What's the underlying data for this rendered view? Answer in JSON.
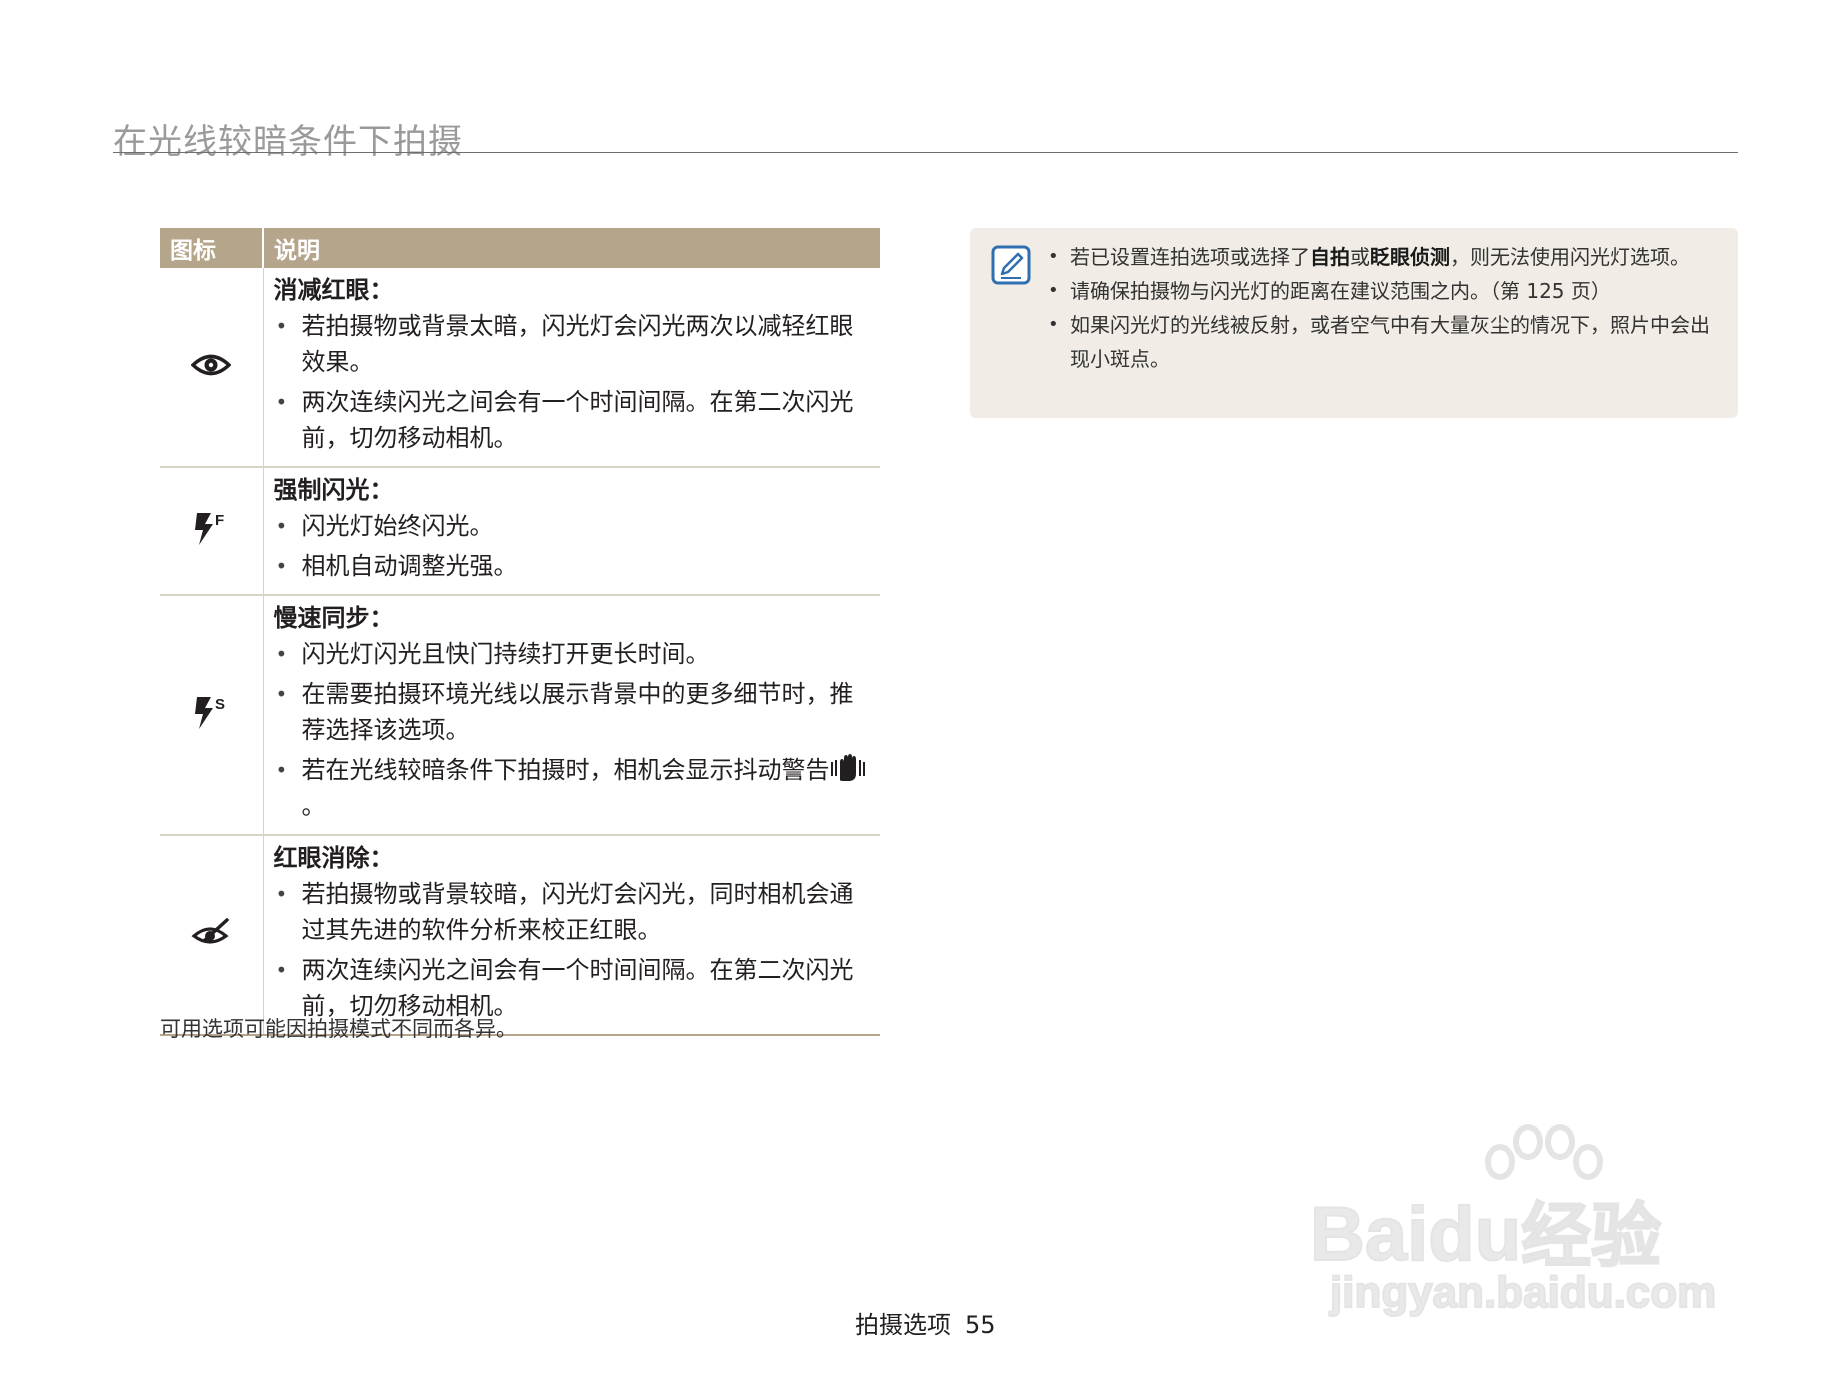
{
  "page": {
    "title": "在光线较暗条件下拍摄",
    "footer_section": "拍摄选项",
    "footer_page": "55"
  },
  "table": {
    "headers": [
      "图标",
      "说明"
    ],
    "rows": [
      {
        "icon": "red-eye-icon",
        "name": "消减红眼：",
        "bullets": [
          "若拍摄物或背景太暗，闪光灯会闪光两次以减轻红眼效果。",
          "两次连续闪光之间会有一个时间间隔。在第二次闪光前，切勿移动相机。"
        ]
      },
      {
        "icon": "fill-in-flash-icon",
        "name": "强制闪光：",
        "bullets": [
          "闪光灯始终闪光。",
          "相机自动调整光强。"
        ]
      },
      {
        "icon": "slow-sync-icon",
        "name": "慢速同步：",
        "bullets": [
          "闪光灯闪光且快门持续打开更长时间。",
          "在需要拍摄环境光线以展示背景中的更多细节时，推荐选择该选项。",
          "若在光线较暗条件下拍摄时，相机会显示抖动警告"
        ],
        "bullet_suffix": "。"
      },
      {
        "icon": "red-eye-fix-icon",
        "name": "红眼消除：",
        "bullets": [
          "若拍摄物或背景较暗，闪光灯会闪光，同时相机会通过其先进的软件分析来校正红眼。",
          "两次连续闪光之间会有一个时间间隔。在第二次闪光前，切勿移动相机。"
        ]
      }
    ],
    "footnote": "可用选项可能因拍摄模式不同而各异。"
  },
  "note": {
    "icon": "note-pen-icon",
    "item1_prefix": "若已设置连拍选项或选择了",
    "item1_bold1": "自拍",
    "item1_mid": "或",
    "item1_bold2": "眨眼侦测",
    "item1_suffix": "，则无法使用闪光灯选项。",
    "item2": "请确保拍摄物与闪光灯的距离在建议范围之内。（第 125 页）",
    "item3": "如果闪光灯的光线被反射，或者空气中有大量灰尘的情况下，照片中会出现小斑点。"
  },
  "watermark": {
    "brand": "Bai",
    "brand2": "du",
    "cn": "经验",
    "url": "jingyan.baidu.com"
  },
  "colors": {
    "header_bg": "#b5a58b",
    "note_bg": "#f1ede6",
    "title_gray": "#9a9a9a"
  }
}
